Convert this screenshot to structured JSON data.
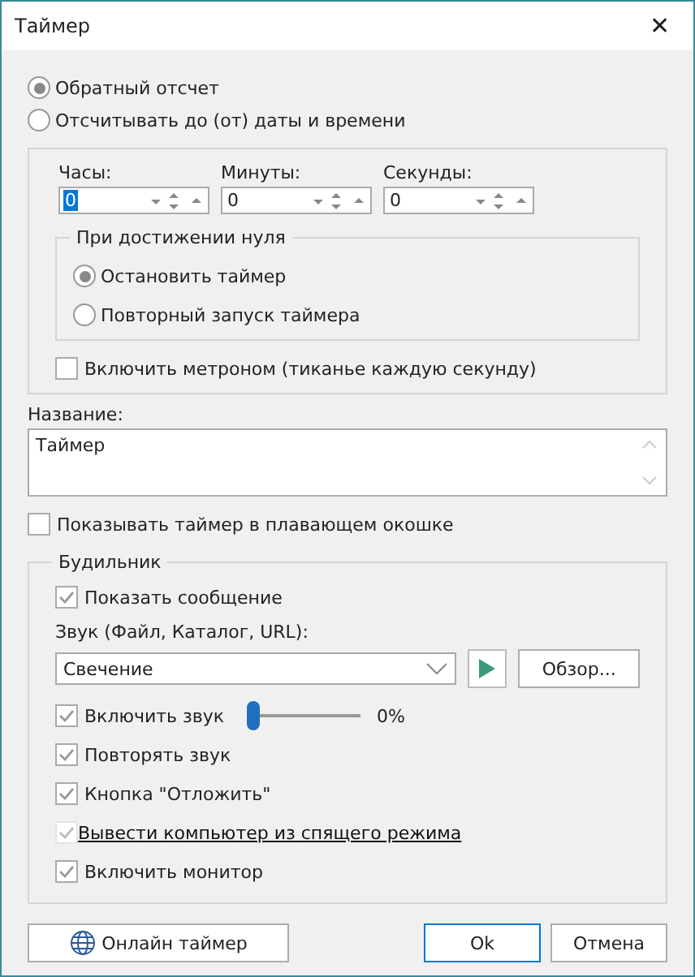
{
  "window": {
    "title": "Таймер",
    "close": "✕"
  },
  "modes": [
    {
      "label": "Обратный отсчет",
      "selected": true
    },
    {
      "label": "Отсчитывать до (от) даты и времени",
      "selected": false
    }
  ],
  "time_fields": [
    {
      "label": "Часы:",
      "value": "0",
      "focused": true
    },
    {
      "label": "Минуты:",
      "value": "0",
      "focused": false
    },
    {
      "label": "Секунды:",
      "value": "0",
      "focused": false
    }
  ],
  "on_zero": {
    "title": "При достижении нуля",
    "options": [
      {
        "label": "Остановить таймер",
        "selected": true
      },
      {
        "label": "Повторный запуск таймера",
        "selected": false
      }
    ]
  },
  "metronome": {
    "label": "Включить метроном (тиканье каждую секунду)",
    "checked": false
  },
  "name": {
    "label": "Название:",
    "value": "Таймер"
  },
  "floating": {
    "label": "Показывать таймер в плавающем окошке",
    "checked": false
  },
  "alarm": {
    "title": "Будильник",
    "show_message": {
      "label": "Показать сообщение",
      "checked": true
    },
    "sound_label": "Звук (Файл, Каталог, URL):",
    "sound_value": "Свечение",
    "browse": "Обзор...",
    "options": [
      {
        "kind": "slider",
        "label": "Включить звук",
        "checked": true,
        "level": 0,
        "reading": "0%"
      },
      {
        "kind": "check",
        "label": "Повторять звук",
        "checked": true
      },
      {
        "kind": "check",
        "label": "Кнопка \"Отложить\"",
        "checked": true
      },
      {
        "kind": "link",
        "label": "Вывести компьютер из спящего режима",
        "checked": true
      },
      {
        "kind": "check",
        "label": "Включить монитор",
        "checked": true
      }
    ]
  },
  "buttons": {
    "online": "Онлайн таймер",
    "ok": "Ok",
    "cancel": "Отмена"
  }
}
